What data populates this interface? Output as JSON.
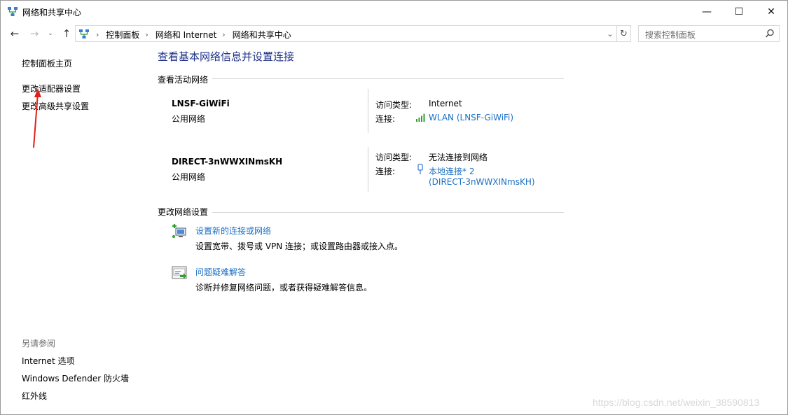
{
  "window": {
    "title": "网络和共享中心",
    "min_glyph": "—",
    "max_glyph": "☐",
    "close_glyph": "✕"
  },
  "nav": {
    "back_glyph": "←",
    "forward_glyph": "→",
    "recent_glyph": "⌄",
    "up_glyph": "↑",
    "breadcrumb": [
      "控制面板",
      "网络和 Internet",
      "网络和共享中心"
    ],
    "separator": "›",
    "dropdown_glyph": "⌄",
    "refresh_glyph": "↻",
    "search_placeholder": "搜索控制面板"
  },
  "sidebar": {
    "home": "控制面板主页",
    "adapter_settings": "更改适配器设置",
    "advanced_sharing": "更改高级共享设置",
    "see_also_title": "另请参阅",
    "see_also": [
      "Internet 选项",
      "Windows Defender 防火墙",
      "红外线"
    ]
  },
  "main": {
    "title": "查看基本网络信息并设置连接",
    "active_networks_title": "查看活动网络",
    "networks": [
      {
        "name": "LNSF-GiWiFi",
        "type": "公用网络",
        "access_label": "访问类型:",
        "access_value": "Internet",
        "conn_label": "连接:",
        "conn_value": "WLAN (LNSF-GiWiFi)",
        "conn_icon": "wifi-signal-icon"
      },
      {
        "name": "DIRECT-3nWWXINmsKH",
        "type": "公用网络",
        "access_label": "访问类型:",
        "access_value": "无法连接到网络",
        "conn_label": "连接:",
        "conn_value_line1": "本地连接* 2",
        "conn_value_line2": "(DIRECT-3nWWXINmsKH)",
        "conn_icon": "ethernet-plug-icon"
      }
    ],
    "change_settings_title": "更改网络设置",
    "tasks": [
      {
        "title": "设置新的连接或网络",
        "desc": "设置宽带、拨号或 VPN 连接；或设置路由器或接入点。",
        "icon": "new-connection-icon"
      },
      {
        "title": "问题疑难解答",
        "desc": "诊断并修复网络问题，或者获得疑难解答信息。",
        "icon": "troubleshoot-icon"
      }
    ]
  },
  "watermark": "https://blog.csdn.net/weixin_38590813",
  "colors": {
    "link": "#1a6fc4",
    "title_blue": "#1e3287",
    "annotation_red": "#e0201a"
  }
}
